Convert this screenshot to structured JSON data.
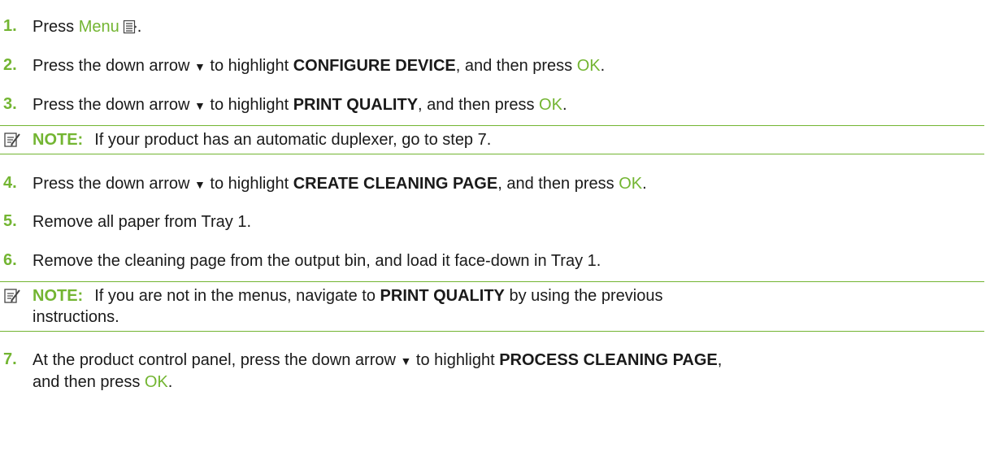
{
  "steps": [
    {
      "num": "1.",
      "parts": [
        "Press ",
        "Menu",
        "."
      ]
    },
    {
      "num": "2.",
      "parts": [
        "Press the down arrow ",
        "▼",
        " to highlight ",
        "CONFIGURE DEVICE",
        ", and then press ",
        "OK",
        "."
      ]
    },
    {
      "num": "3.",
      "parts": [
        "Press the down arrow ",
        "▼",
        " to highlight ",
        "PRINT QUALITY",
        ", and then press ",
        "OK",
        "."
      ]
    },
    {
      "num": "4.",
      "parts": [
        "Press the down arrow ",
        "▼",
        " to highlight ",
        "CREATE CLEANING PAGE",
        ", and then press ",
        "OK",
        "."
      ]
    },
    {
      "num": "5.",
      "text": "Remove all paper from Tray 1."
    },
    {
      "num": "6.",
      "text": "Remove the cleaning page from the output bin, and load it face-down in Tray 1."
    },
    {
      "num": "7.",
      "parts": [
        "At the product control panel, press the down arrow ",
        "▼",
        " to highlight ",
        "PROCESS CLEANING PAGE",
        ",",
        "and then press ",
        "OK",
        "."
      ]
    }
  ],
  "notes": [
    {
      "label": "NOTE:",
      "text": "If your product has an automatic duplexer, go to step 7."
    },
    {
      "label": "NOTE:",
      "parts": [
        "If you are not in the menus, navigate to ",
        "PRINT QUALITY",
        " by using the previous",
        "instructions."
      ]
    }
  ],
  "colors": {
    "accent": "#73b532",
    "text": "#1a1a1a"
  },
  "icons": {
    "menu": "menu-icon",
    "note": "note-icon"
  }
}
